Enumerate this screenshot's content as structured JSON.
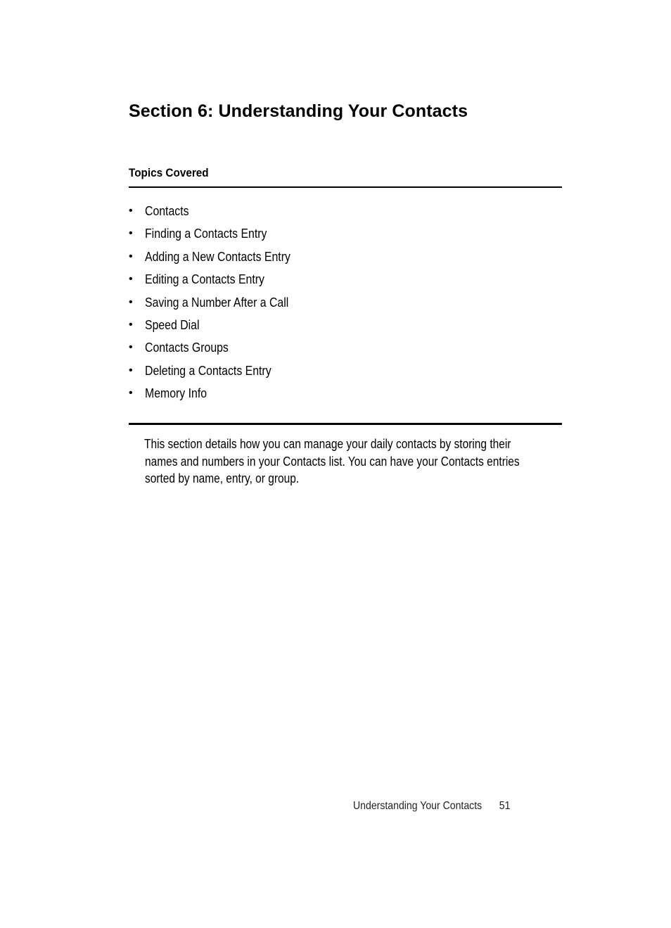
{
  "page": {
    "title": "Section 6: Understanding Your Contacts",
    "topics_heading": "Topics Covered",
    "topics": [
      "Contacts",
      "Finding a Contacts Entry",
      "Adding a New Contacts Entry",
      "Editing a Contacts Entry",
      "Saving a Number After a Call",
      "Speed Dial",
      "Contacts Groups",
      "Deleting a Contacts Entry",
      "Memory Info"
    ],
    "bullet_glyph": "•",
    "intro_lines": [
      "This section details how you can manage your daily contacts by storing their",
      "names and numbers in your Contacts list. You can have your Contacts entries",
      "sorted by name, entry, or group."
    ],
    "footer": {
      "chapter": "Understanding Your Contacts",
      "page_number": "51"
    }
  }
}
